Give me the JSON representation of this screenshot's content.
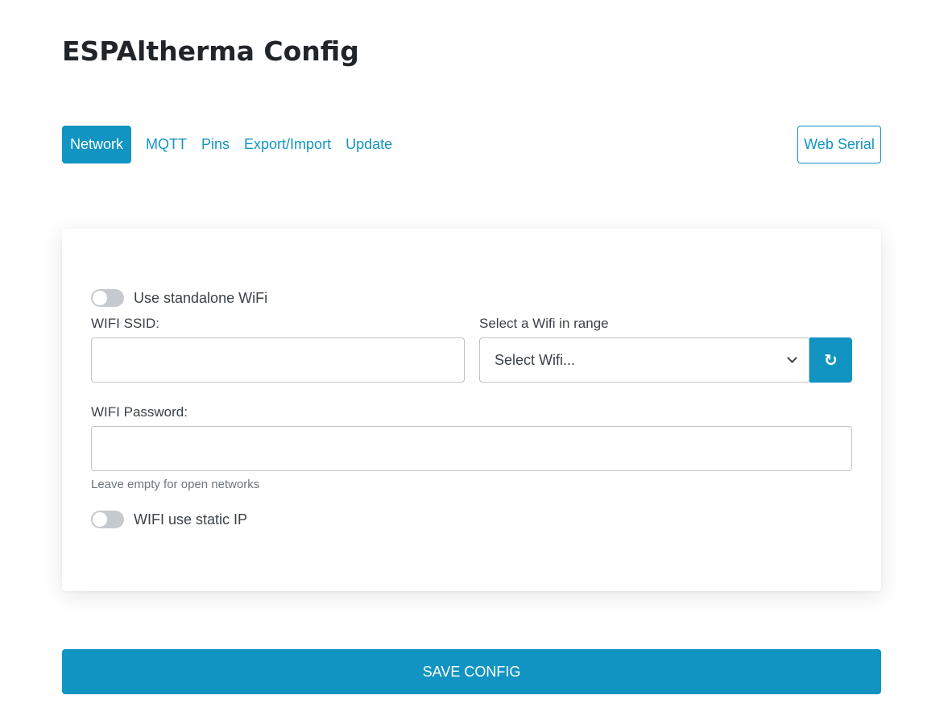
{
  "app": {
    "title": "ESPAltherma Config"
  },
  "nav": {
    "tabs": [
      {
        "label": "Network",
        "active": true
      },
      {
        "label": "MQTT",
        "active": false
      },
      {
        "label": "Pins",
        "active": false
      },
      {
        "label": "Export/Import",
        "active": false
      },
      {
        "label": "Update",
        "active": false
      }
    ],
    "web_serial_label": "Web Serial"
  },
  "network": {
    "standalone_wifi": {
      "label": "Use standalone WiFi",
      "checked": false
    },
    "ssid": {
      "label": "WIFI SSID:",
      "value": ""
    },
    "wifi_select": {
      "label": "Select a Wifi in range",
      "selected": "Select Wifi...",
      "refresh_icon": "↻"
    },
    "password": {
      "label": "WIFI Password:",
      "value": "",
      "help": "Leave empty for open networks"
    },
    "static_ip": {
      "label": "WIFI use static IP",
      "checked": false
    }
  },
  "actions": {
    "save_label": "SAVE CONFIG"
  },
  "colors": {
    "accent": "#1194c1",
    "switch_off": "#c6cacf",
    "text": "#212529"
  }
}
